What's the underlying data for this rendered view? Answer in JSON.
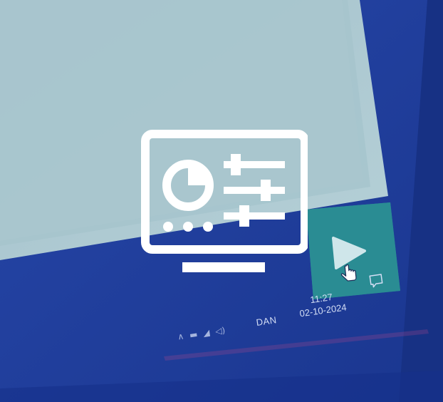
{
  "overlay": {
    "icon": "monitor-dashboard-settings-icon"
  },
  "screen": {
    "play_icon": "play-icon",
    "cursor_icon": "hand-pointer-icon"
  },
  "taskbar": {
    "tray_icons": [
      "chevron-up-icon",
      "folder-icon",
      "network-icon",
      "volume-icon"
    ],
    "language": "DAN",
    "time": "11:27",
    "date": "02-10-2024",
    "notification_icon": "notification-icon"
  },
  "colors": {
    "window_bg": "#a9c6cf",
    "taskbar_blue": "#1f3fa0",
    "tile_teal": "#2a8c93",
    "overlay_white": "#ffffff"
  }
}
